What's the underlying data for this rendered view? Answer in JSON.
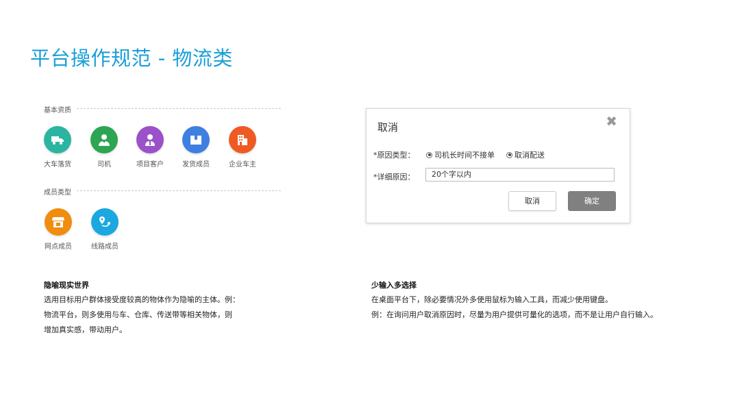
{
  "page": {
    "title": "平台操作规范 - 物流类"
  },
  "basic_section": {
    "label": "基本资质",
    "items": [
      {
        "label": "大车落货",
        "icon": "truck-icon",
        "color": "#2bb5a0"
      },
      {
        "label": "司机",
        "icon": "driver-icon",
        "color": "#2ea553"
      },
      {
        "label": "项目客户",
        "icon": "customer-icon",
        "color": "#9b51c9"
      },
      {
        "label": "发货成员",
        "icon": "package-icon",
        "color": "#3f7fe0"
      },
      {
        "label": "企业车主",
        "icon": "building-icon",
        "color": "#ef5a24"
      }
    ]
  },
  "member_section": {
    "label": "成员类型",
    "items": [
      {
        "label": "网点成员",
        "icon": "store-icon",
        "color": "#f08c0e"
      },
      {
        "label": "线路成员",
        "icon": "route-icon",
        "color": "#1ba8e0"
      }
    ]
  },
  "dialog": {
    "title": "取消",
    "close_glyph": "✖",
    "reason_type_label": "*原因类型：",
    "option_1": "司机长时间不接单",
    "option_2": "取消配送",
    "detail_label": "*详细原因：",
    "detail_value": "20个字以内",
    "cancel_button": "取消",
    "ok_button": "确定"
  },
  "left_desc": {
    "heading": "隐喻现实世界",
    "lines": [
      "选用目标用户群体接受度较高的物体作为隐喻的主体。例：",
      "物流平台，则多使用与车、仓库、传送带等相关物体，则",
      "增加真实感，带动用户。"
    ]
  },
  "right_desc": {
    "heading": "少输入多选择",
    "lines": [
      "在桌面平台下，除必要情况外多使用鼠标为输入工具，而减少使用键盘。",
      "例：在询问用户取消原因时，尽量为用户提供可量化的选项，而不是让用户自行输入。"
    ]
  }
}
